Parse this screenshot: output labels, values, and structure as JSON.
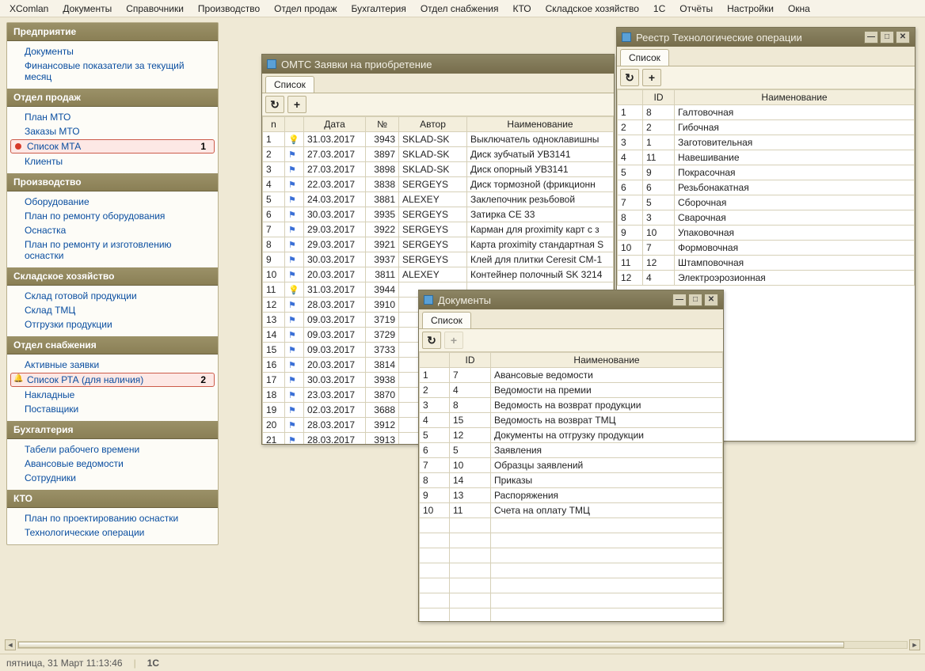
{
  "menubar": [
    "XComlan",
    "Документы",
    "Справочники",
    "Производство",
    "Отдел продаж",
    "Бухгалтерия",
    "Отдел снабжения",
    "КТО",
    "Складское хозяйство",
    "1С",
    "Отчёты",
    "Настройки",
    "Окна"
  ],
  "sidebar": [
    {
      "title": "Предприятие",
      "items": [
        {
          "label": "Документы"
        },
        {
          "label": "Финансовые показатели за текущий месяц"
        }
      ]
    },
    {
      "title": "Отдел продаж",
      "items": [
        {
          "label": "План МТО"
        },
        {
          "label": "Заказы МТО"
        },
        {
          "label": "Список МТА",
          "alert": true,
          "badge": "1",
          "icon": "pin"
        },
        {
          "label": "Клиенты"
        }
      ]
    },
    {
      "title": "Производство",
      "items": [
        {
          "label": "Оборудование"
        },
        {
          "label": "План по ремонту оборудования"
        },
        {
          "label": "Оснастка"
        },
        {
          "label": "План по ремонту и изготовлению оснастки"
        }
      ]
    },
    {
      "title": "Складское хозяйство",
      "items": [
        {
          "label": "Склад готовой продукции"
        },
        {
          "label": "Склад ТМЦ"
        },
        {
          "label": "Отгрузки продукции"
        }
      ]
    },
    {
      "title": "Отдел снабжения",
      "items": [
        {
          "label": "Активные заявки"
        },
        {
          "label": "Список РТА (для наличия)",
          "alert": true,
          "badge": "2",
          "icon": "bell"
        },
        {
          "label": "Накладные"
        },
        {
          "label": "Поставщики"
        }
      ]
    },
    {
      "title": "Бухгалтерия",
      "items": [
        {
          "label": "Табели рабочего времени"
        },
        {
          "label": "Авансовые ведомости"
        },
        {
          "label": "Сотрудники"
        }
      ]
    },
    {
      "title": "КТО",
      "items": [
        {
          "label": "План по проектированию оснастки"
        },
        {
          "label": "Технологические операции"
        }
      ]
    }
  ],
  "win_omts": {
    "title": "ОМТС Заявки на приобретение",
    "tab": "Список",
    "headers": [
      "n",
      "",
      "Дата",
      "№",
      "Автор",
      "Наименование"
    ],
    "rows": [
      {
        "n": "1",
        "icon": "bulb",
        "date": "31.03.2017",
        "no": "3943",
        "author": "SKLAD-SK",
        "name": "Выключатель одноклавишны"
      },
      {
        "n": "2",
        "icon": "flag",
        "date": "27.03.2017",
        "no": "3897",
        "author": "SKLAD-SK",
        "name": "Диск зубчатый УВ3141"
      },
      {
        "n": "3",
        "icon": "flag",
        "date": "27.03.2017",
        "no": "3898",
        "author": "SKLAD-SK",
        "name": "Диск опорный УВ3141"
      },
      {
        "n": "4",
        "icon": "flag",
        "date": "22.03.2017",
        "no": "3838",
        "author": "SERGEYS",
        "name": "Диск тормозной (фрикционн"
      },
      {
        "n": "5",
        "icon": "flag",
        "date": "24.03.2017",
        "no": "3881",
        "author": "ALEXEY",
        "name": "Заклепочник резьбовой"
      },
      {
        "n": "6",
        "icon": "flag",
        "date": "30.03.2017",
        "no": "3935",
        "author": "SERGEYS",
        "name": "Затирка CE 33"
      },
      {
        "n": "7",
        "icon": "flag",
        "date": "29.03.2017",
        "no": "3922",
        "author": "SERGEYS",
        "name": "Карман для proximity карт с з"
      },
      {
        "n": "8",
        "icon": "flag",
        "date": "29.03.2017",
        "no": "3921",
        "author": "SERGEYS",
        "name": "Карта proximity стандартная S"
      },
      {
        "n": "9",
        "icon": "flag",
        "date": "30.03.2017",
        "no": "3937",
        "author": "SERGEYS",
        "name": "Клей для плитки Ceresit CM-1"
      },
      {
        "n": "10",
        "icon": "flag",
        "date": "20.03.2017",
        "no": "3811",
        "author": "ALEXEY",
        "name": "Контейнер полочный SK 3214"
      },
      {
        "n": "11",
        "icon": "bulb",
        "date": "31.03.2017",
        "no": "3944",
        "author": "",
        "name": ""
      },
      {
        "n": "12",
        "icon": "flag",
        "date": "28.03.2017",
        "no": "3910",
        "author": "",
        "name": ""
      },
      {
        "n": "13",
        "icon": "flag",
        "date": "09.03.2017",
        "no": "3719",
        "author": "",
        "name": ""
      },
      {
        "n": "14",
        "icon": "flag",
        "date": "09.03.2017",
        "no": "3729",
        "author": "",
        "name": ""
      },
      {
        "n": "15",
        "icon": "flag",
        "date": "09.03.2017",
        "no": "3733",
        "author": "",
        "name": ""
      },
      {
        "n": "16",
        "icon": "flag",
        "date": "20.03.2017",
        "no": "3814",
        "author": "",
        "name": ""
      },
      {
        "n": "17",
        "icon": "flag",
        "date": "30.03.2017",
        "no": "3938",
        "author": "",
        "name": ""
      },
      {
        "n": "18",
        "icon": "flag",
        "date": "23.03.2017",
        "no": "3870",
        "author": "",
        "name": ""
      },
      {
        "n": "19",
        "icon": "flag",
        "date": "02.03.2017",
        "no": "3688",
        "author": "",
        "name": ""
      },
      {
        "n": "20",
        "icon": "flag",
        "date": "28.03.2017",
        "no": "3912",
        "author": "",
        "name": ""
      },
      {
        "n": "21",
        "icon": "flag",
        "date": "28.03.2017",
        "no": "3913",
        "author": "",
        "name": ""
      }
    ]
  },
  "win_reestr": {
    "title": "Реестр Технологические операции",
    "tab": "Список",
    "headers": [
      "",
      "ID",
      "Наименование"
    ],
    "rows": [
      {
        "n": "1",
        "id": "8",
        "name": "Галтовочная"
      },
      {
        "n": "2",
        "id": "2",
        "name": "Гибочная"
      },
      {
        "n": "3",
        "id": "1",
        "name": "Заготовительная"
      },
      {
        "n": "4",
        "id": "11",
        "name": "Навешивание"
      },
      {
        "n": "5",
        "id": "9",
        "name": "Покрасочная"
      },
      {
        "n": "6",
        "id": "6",
        "name": "Резьбонакатная"
      },
      {
        "n": "7",
        "id": "5",
        "name": "Сборочная"
      },
      {
        "n": "8",
        "id": "3",
        "name": "Сварочная"
      },
      {
        "n": "9",
        "id": "10",
        "name": "Упаковочная"
      },
      {
        "n": "10",
        "id": "7",
        "name": "Формовочная"
      },
      {
        "n": "11",
        "id": "12",
        "name": "Штамповочная"
      },
      {
        "n": "12",
        "id": "4",
        "name": "Электроэрозионная"
      }
    ]
  },
  "win_docs": {
    "title": "Документы",
    "tab": "Список",
    "headers": [
      "",
      "ID",
      "Наименование"
    ],
    "rows": [
      {
        "n": "1",
        "id": "7",
        "name": "Авансовые ведомости"
      },
      {
        "n": "2",
        "id": "4",
        "name": "Ведомости на премии"
      },
      {
        "n": "3",
        "id": "8",
        "name": "Ведомость на возврат продукции"
      },
      {
        "n": "4",
        "id": "15",
        "name": "Ведомость на возврат ТМЦ"
      },
      {
        "n": "5",
        "id": "12",
        "name": "Документы на отгрузку продукции"
      },
      {
        "n": "6",
        "id": "5",
        "name": "Заявления"
      },
      {
        "n": "7",
        "id": "10",
        "name": "Образцы заявлений"
      },
      {
        "n": "8",
        "id": "14",
        "name": "Приказы"
      },
      {
        "n": "9",
        "id": "13",
        "name": "Распоряжения"
      },
      {
        "n": "10",
        "id": "11",
        "name": "Счета на оплату ТМЦ"
      }
    ],
    "blank_rows": 7
  },
  "status": {
    "date": "пятница, 31 Март 11:13:46",
    "logo": "1С"
  }
}
